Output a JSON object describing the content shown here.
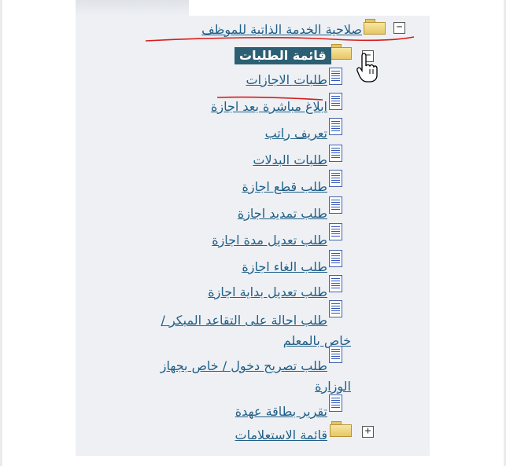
{
  "tree": {
    "root": {
      "toggle": "−",
      "label": "صلاحية الخدمة الذاتية للموظف"
    },
    "requests": {
      "toggle": "−",
      "label": "قائمة الطلبات",
      "items": [
        "طلبات الاجازات",
        "ابلاغ مباشرة بعد اجازة",
        "تعريف راتب",
        "طلبات البدلات",
        "طلب قطع اجازة",
        "طلب تمديد اجازة",
        "طلب تعديل مدة اجازة",
        "طلب الغاء اجازة",
        "طلب تعديل بداية اجازة",
        "طلب احالة على التقاعد المبكر /",
        "خاص بالمعلم",
        "طلب تصريح دخول / خاص بجهاز",
        "الوزارة",
        "تقرير بطاقة عهدة"
      ]
    },
    "inquiries": {
      "toggle": "+",
      "label": "قائمة الاستعلامات"
    }
  },
  "icons": {
    "folder": "folder-icon",
    "page": "page-icon",
    "cursor": "hand-cursor-icon"
  },
  "colors": {
    "link": "#1f5f87",
    "selected_bg": "#2c5f73",
    "annotation": "#d81b1b"
  }
}
